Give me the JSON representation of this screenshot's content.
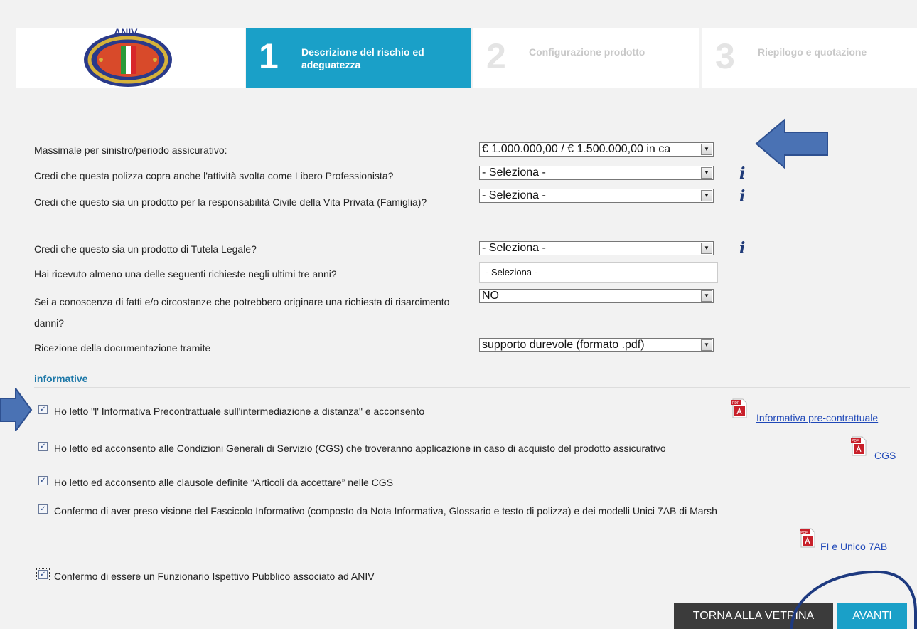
{
  "colors": {
    "accent": "#1aa0c8",
    "dark_button": "#3b3b3b",
    "link": "#1f48b8",
    "section": "#1d78a8"
  },
  "stepper": {
    "logo_text": "ANIV",
    "steps": [
      {
        "number": "1",
        "label": "Descrizione del rischio ed adeguatezza",
        "active": true
      },
      {
        "number": "2",
        "label": "Configurazione prodotto",
        "active": false
      },
      {
        "number": "3",
        "label": "Riepilogo e quotazione",
        "active": false
      }
    ]
  },
  "form": {
    "massimale": {
      "label": "Massimale per sinistro/periodo assicurativo:",
      "value": "€ 1.000.000,00 / € 1.500.000,00 in ca"
    },
    "libero_prof": {
      "label": "Credi che questa polizza copra anche l'attività svolta come Libero Professionista?",
      "value": "- Seleziona -"
    },
    "vita_privata": {
      "label": "Credi che questo sia un prodotto per la responsabilità Civile della Vita Privata (Famiglia)?",
      "value": "- Seleziona -"
    },
    "tutela_legale": {
      "label": "Credi che questo sia un prodotto di Tutela Legale?",
      "value": "- Seleziona -"
    },
    "richieste": {
      "label": "Hai ricevuto almeno una delle seguenti richieste negli ultimi tre anni?",
      "value": "- Seleziona -"
    },
    "circostanze": {
      "label": "Sei a conoscenza di fatti e/o circostanze che potrebbero originare una richiesta di risarcimento danni?",
      "value": "NO"
    },
    "ricezione": {
      "label": "Ricezione della documentazione tramite",
      "value": "supporto durevole (formato .pdf)"
    }
  },
  "informative": {
    "title": "informative",
    "items": [
      {
        "text": "Ho letto \"l' Informativa Precontrattuale sull'intermediazione a distanza\" e acconsento",
        "checked": true
      },
      {
        "text": "Ho letto ed acconsento alle Condizioni Generali di Servizio (CGS) che troveranno applicazione in caso di acquisto del prodotto assicurativo",
        "checked": true
      },
      {
        "text": "Ho letto ed acconsento alle clausole definite “Articoli da accettare” nelle CGS",
        "checked": true
      },
      {
        "text": "Confermo di aver preso visione del Fascicolo Informativo (composto da Nota Informativa, Glossario e testo di polizza) e dei modelli Unici 7AB di Marsh",
        "checked": true
      },
      {
        "text": "Confermo di essere un Funzionario Ispettivo Pubblico associato ad ANIV",
        "checked": true
      }
    ],
    "links": {
      "precontrattuale": "Informativa pre-contrattuale",
      "cgs": "CGS",
      "fi": "FI e Unico 7AB"
    },
    "pdf_badge": "PDF"
  },
  "buttons": {
    "back": "TORNA ALLA VETRINA",
    "next": "AVANTI"
  },
  "icons": {
    "checkbox": "✓",
    "dropdown": "▼",
    "info": "i"
  }
}
